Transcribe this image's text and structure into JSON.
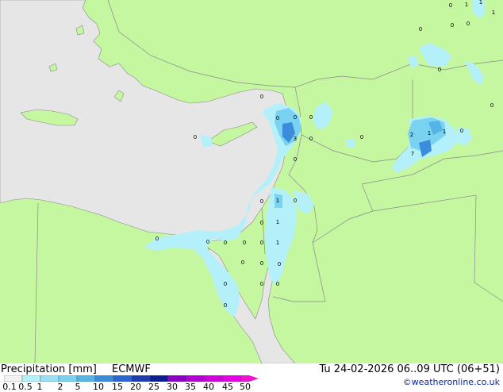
{
  "footer": {
    "title": "Precipitation [mm]",
    "model": "ECMWF",
    "valid_time": "Tu 24-02-2026 06..09 UTC (06+51)",
    "credit": "©weatheronline.co.uk"
  },
  "legend": {
    "ticks": [
      "0.1",
      "0.5",
      "1",
      "2",
      "5",
      "10",
      "15",
      "20",
      "25",
      "30",
      "35",
      "40",
      "45",
      "50"
    ],
    "colors": [
      "#f2f2f2",
      "#b4f0fa",
      "#96e1f5",
      "#78d2f0",
      "#55b4e6",
      "#3c8cdc",
      "#2c64d2",
      "#1e3cb4",
      "#0a1e96",
      "#8c00c8",
      "#b400d2",
      "#d200dc",
      "#e600e6",
      "#f014d2"
    ]
  },
  "map": {
    "land_color": "#c4f7a0",
    "sea_color": "#e6e6e6",
    "light_precip": "#b4f0fa",
    "mid_precip": "#78d2f0",
    "heavy_precip": "#3c8cdc",
    "labels": [
      "0",
      "1",
      "1",
      "1",
      "0",
      "0",
      "0",
      "0",
      "0",
      "0",
      "0",
      "0",
      "0",
      "3",
      "0",
      "0",
      "2",
      "1",
      "1",
      "0",
      "7",
      "0",
      "0",
      "1",
      "0",
      "0",
      "1",
      "0",
      "0",
      "0",
      "0",
      "0",
      "1",
      "0",
      "0",
      "0",
      "0",
      "0",
      "0",
      "0",
      "0"
    ]
  }
}
